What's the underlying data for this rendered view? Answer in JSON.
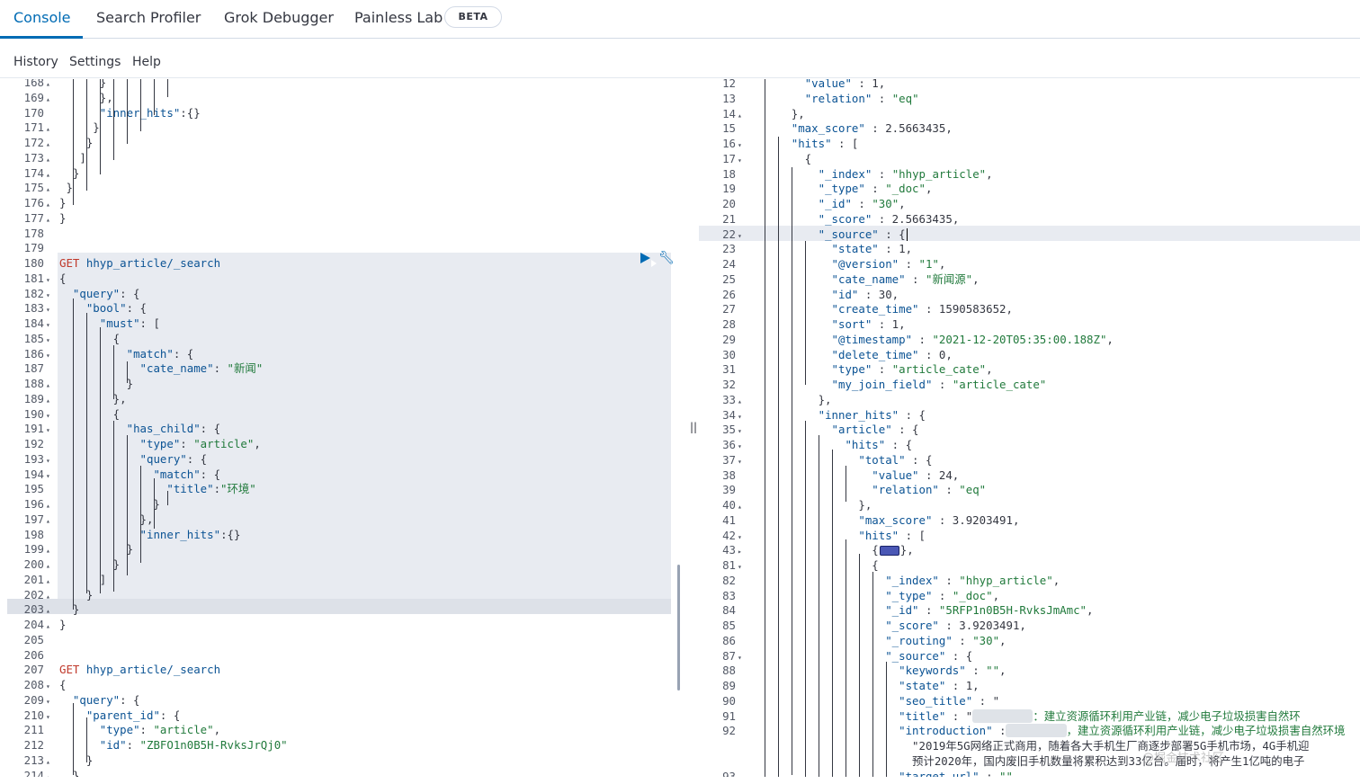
{
  "tabs": [
    {
      "label": "Console",
      "active": true
    },
    {
      "label": "Search Profiler",
      "active": false
    },
    {
      "label": "Grok Debugger",
      "active": false
    },
    {
      "label": "Painless Lab",
      "active": false
    }
  ],
  "beta_badge": "BETA",
  "menu": [
    "History",
    "Settings",
    "Help"
  ],
  "divider_glyph": "||",
  "watermark": "@掘金技术社区",
  "colors": {
    "accent": "#006bb4",
    "method": "#c0392b",
    "key": "#0b5394",
    "string": "#217a3c"
  },
  "icons": {
    "run": "play-icon",
    "wrench": "wrench-icon",
    "fold": "fold-arrow-icon"
  },
  "left_lines": [
    {
      "n": "168",
      "f": "up",
      "t": "      }"
    },
    {
      "n": "169",
      "f": "up",
      "t": "      },"
    },
    {
      "n": "170",
      "f": "",
      "t": "      \"inner_hits\":{}"
    },
    {
      "n": "171",
      "f": "up",
      "t": "     }"
    },
    {
      "n": "172",
      "f": "up",
      "t": "    }"
    },
    {
      "n": "173",
      "f": "up",
      "t": "   ]"
    },
    {
      "n": "174",
      "f": "up",
      "t": "  }"
    },
    {
      "n": "175",
      "f": "up",
      "t": " }"
    },
    {
      "n": "176",
      "f": "up",
      "t": "}"
    },
    {
      "n": "177",
      "f": "up",
      "t": "}"
    },
    {
      "n": "178",
      "f": "",
      "t": ""
    },
    {
      "n": "179",
      "f": "",
      "t": ""
    },
    {
      "n": "180",
      "f": "",
      "t": "GET hhyp_article/_search"
    },
    {
      "n": "181",
      "f": "down",
      "t": "{"
    },
    {
      "n": "182",
      "f": "down",
      "t": "  \"query\": {"
    },
    {
      "n": "183",
      "f": "down",
      "t": "    \"bool\": {"
    },
    {
      "n": "184",
      "f": "down",
      "t": "      \"must\": ["
    },
    {
      "n": "185",
      "f": "down",
      "t": "        {"
    },
    {
      "n": "186",
      "f": "down",
      "t": "          \"match\": {"
    },
    {
      "n": "187",
      "f": "",
      "t": "            \"cate_name\": \"新闻\""
    },
    {
      "n": "188",
      "f": "up",
      "t": "          }"
    },
    {
      "n": "189",
      "f": "up",
      "t": "        },"
    },
    {
      "n": "190",
      "f": "down",
      "t": "        {"
    },
    {
      "n": "191",
      "f": "down",
      "t": "          \"has_child\": {"
    },
    {
      "n": "192",
      "f": "",
      "t": "            \"type\": \"article\","
    },
    {
      "n": "193",
      "f": "down",
      "t": "            \"query\": {"
    },
    {
      "n": "194",
      "f": "down",
      "t": "              \"match\": {"
    },
    {
      "n": "195",
      "f": "",
      "t": "                \"title\":\"环境\""
    },
    {
      "n": "196",
      "f": "up",
      "t": "              }"
    },
    {
      "n": "197",
      "f": "up",
      "t": "            },"
    },
    {
      "n": "198",
      "f": "",
      "t": "            \"inner_hits\":{}"
    },
    {
      "n": "199",
      "f": "up",
      "t": "          }"
    },
    {
      "n": "200",
      "f": "up",
      "t": "        }"
    },
    {
      "n": "201",
      "f": "up",
      "t": "      ]"
    },
    {
      "n": "202",
      "f": "up",
      "t": "    }"
    },
    {
      "n": "203",
      "f": "up",
      "t": "  }"
    },
    {
      "n": "204",
      "f": "up",
      "t": "}"
    },
    {
      "n": "205",
      "f": "",
      "t": ""
    },
    {
      "n": "206",
      "f": "",
      "t": ""
    },
    {
      "n": "207",
      "f": "",
      "t": "GET hhyp_article/_search"
    },
    {
      "n": "208",
      "f": "down",
      "t": "{"
    },
    {
      "n": "209",
      "f": "down",
      "t": "  \"query\": {"
    },
    {
      "n": "210",
      "f": "down",
      "t": "    \"parent_id\": {"
    },
    {
      "n": "211",
      "f": "",
      "t": "      \"type\": \"article\","
    },
    {
      "n": "212",
      "f": "",
      "t": "      \"id\": \"ZBFO1n0B5H-RvksJrQj0\""
    },
    {
      "n": "213",
      "f": "up",
      "t": "    }"
    },
    {
      "n": "214",
      "f": "up",
      "t": "  },"
    }
  ],
  "right_lines": [
    {
      "n": "12",
      "f": "",
      "t": "        \"value\" : 1,"
    },
    {
      "n": "13",
      "f": "",
      "t": "        \"relation\" : \"eq\""
    },
    {
      "n": "14",
      "f": "up",
      "t": "      },"
    },
    {
      "n": "15",
      "f": "",
      "t": "      \"max_score\" : 2.5663435,"
    },
    {
      "n": "16",
      "f": "down",
      "t": "      \"hits\" : ["
    },
    {
      "n": "17",
      "f": "down",
      "t": "        {"
    },
    {
      "n": "18",
      "f": "",
      "t": "          \"_index\" : \"hhyp_article\","
    },
    {
      "n": "19",
      "f": "",
      "t": "          \"_type\" : \"_doc\","
    },
    {
      "n": "20",
      "f": "",
      "t": "          \"_id\" : \"30\","
    },
    {
      "n": "21",
      "f": "",
      "t": "          \"_score\" : 2.5663435,"
    },
    {
      "n": "22",
      "f": "down",
      "t": "          \"_source\" : {"
    },
    {
      "n": "23",
      "f": "",
      "t": "            \"state\" : 1,"
    },
    {
      "n": "24",
      "f": "",
      "t": "            \"@version\" : \"1\","
    },
    {
      "n": "25",
      "f": "",
      "t": "            \"cate_name\" : \"新闻源\","
    },
    {
      "n": "26",
      "f": "",
      "t": "            \"id\" : 30,"
    },
    {
      "n": "27",
      "f": "",
      "t": "            \"create_time\" : 1590583652,"
    },
    {
      "n": "28",
      "f": "",
      "t": "            \"sort\" : 1,"
    },
    {
      "n": "29",
      "f": "",
      "t": "            \"@timestamp\" : \"2021-12-20T05:35:00.188Z\","
    },
    {
      "n": "30",
      "f": "",
      "t": "            \"delete_time\" : 0,"
    },
    {
      "n": "31",
      "f": "",
      "t": "            \"type\" : \"article_cate\","
    },
    {
      "n": "32",
      "f": "",
      "t": "            \"my_join_field\" : \"article_cate\""
    },
    {
      "n": "33",
      "f": "up",
      "t": "          },"
    },
    {
      "n": "34",
      "f": "down",
      "t": "          \"inner_hits\" : {"
    },
    {
      "n": "35",
      "f": "down",
      "t": "            \"article\" : {"
    },
    {
      "n": "36",
      "f": "down",
      "t": "              \"hits\" : {"
    },
    {
      "n": "37",
      "f": "down",
      "t": "                \"total\" : {"
    },
    {
      "n": "38",
      "f": "",
      "t": "                  \"value\" : 24,"
    },
    {
      "n": "39",
      "f": "",
      "t": "                  \"relation\" : \"eq\""
    },
    {
      "n": "40",
      "f": "up",
      "t": "                },"
    },
    {
      "n": "41",
      "f": "",
      "t": "                \"max_score\" : 3.9203491,"
    },
    {
      "n": "42",
      "f": "down",
      "t": "                \"hits\" : ["
    },
    {
      "n": "43",
      "f": "right",
      "t": "                  {"
    },
    {
      "n": "81",
      "f": "down",
      "t": "                  {"
    },
    {
      "n": "82",
      "f": "",
      "t": "                    \"_index\" : \"hhyp_article\","
    },
    {
      "n": "83",
      "f": "",
      "t": "                    \"_type\" : \"_doc\","
    },
    {
      "n": "84",
      "f": "",
      "t": "                    \"_id\" : \"5RFP1n0B5H-RvksJmAmc\","
    },
    {
      "n": "85",
      "f": "",
      "t": "                    \"_score\" : 3.9203491,"
    },
    {
      "n": "86",
      "f": "",
      "t": "                    \"_routing\" : \"30\","
    },
    {
      "n": "87",
      "f": "down",
      "t": "                    \"_source\" : {"
    },
    {
      "n": "88",
      "f": "",
      "t": "                      \"keywords\" : \"\","
    },
    {
      "n": "89",
      "f": "",
      "t": "                      \"state\" : 1,"
    },
    {
      "n": "90",
      "f": "",
      "t": "                      \"seo_title\" : \""
    },
    {
      "n": "91",
      "f": "",
      "t": "                      \"title\" : \""
    },
    {
      "n": "92",
      "f": "",
      "t": "                      \"introduction\" :"
    },
    {
      "n": "",
      "f": "",
      "t": "                        \"2019年5G网络正式商用，随着各大手机生厂商逐步部署5G手机市场，4G手机迎"
    },
    {
      "n": "",
      "f": "",
      "t": "                        预计2020年，国内废旧手机数量将累积达到33亿台。届时，将产生1亿吨的电子"
    },
    {
      "n": "93",
      "f": "",
      "t": "                      \"target_url\" : \"\","
    }
  ],
  "seo_title_tail": "：建立资源循环利用产业链，减少电子垃圾损害自然环",
  "title_tail": "，建立资源循环利用产业链，减少电子垃圾损害自然环境"
}
